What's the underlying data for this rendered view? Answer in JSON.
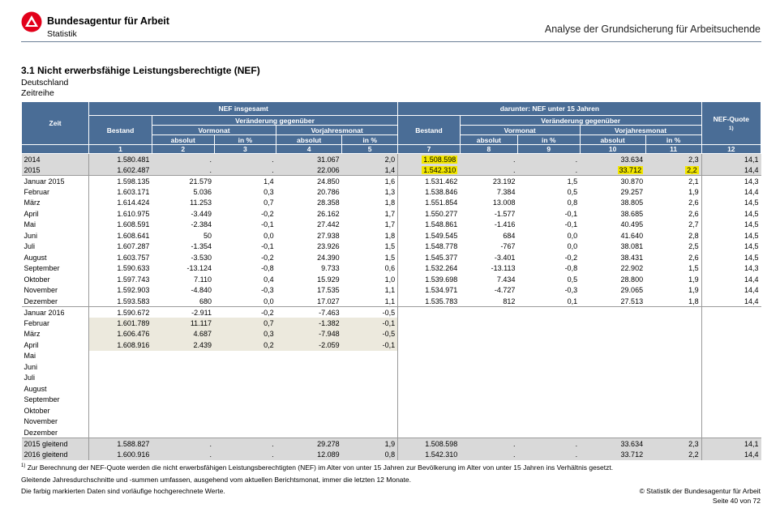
{
  "header": {
    "org_name": "Bundesagentur für Arbeit",
    "org_sub": "Statistik",
    "title": "Analyse der Grundsicherung für Arbeitsuchende",
    "logo_color": "#e2001a"
  },
  "section": {
    "title": "3.1 Nicht erwerbsfähige Leistungsberechtigte (NEF)",
    "region": "Deutschland",
    "series": "Zeitreihe"
  },
  "table": {
    "group_all": "NEF insgesamt",
    "group_u15": "darunter: NEF unter 15 Jahren",
    "zeit": "Zeit",
    "bestand": "Bestand",
    "veraenderung": "Veränderung gegenüber",
    "vormonat": "Vormonat",
    "vorjahresmonat": "Vorjahresmonat",
    "absolut": "absolut",
    "in_pct": "in %",
    "quote": "NEF-Quote",
    "quote_note": "1)",
    "col_numbers": [
      "1",
      "2",
      "3",
      "4",
      "5",
      "7",
      "8",
      "9",
      "10",
      "11",
      "12"
    ],
    "rows": [
      {
        "cells": [
          "2014",
          "1.580.481",
          ".",
          ".",
          "31.067",
          "2,0",
          "1.508.598",
          ".",
          ".",
          "33.634",
          "2,3",
          "14,1"
        ]
      },
      {
        "cells": [
          "2015",
          "1.602.487",
          ".",
          ".",
          "22.006",
          "1,4",
          "1.542.310",
          ".",
          ".",
          "33.712",
          "2,2",
          "14,4"
        ]
      },
      {
        "cells": [
          "Januar 2015",
          "1.598.135",
          "21.579",
          "1,4",
          "24.850",
          "1,6",
          "1.531.462",
          "23.192",
          "1,5",
          "30.870",
          "2,1",
          "14,3"
        ]
      },
      {
        "cells": [
          "Februar",
          "1.603.171",
          "5.036",
          "0,3",
          "20.786",
          "1,3",
          "1.538.846",
          "7.384",
          "0,5",
          "29.257",
          "1,9",
          "14,4"
        ]
      },
      {
        "cells": [
          "März",
          "1.614.424",
          "11.253",
          "0,7",
          "28.358",
          "1,8",
          "1.551.854",
          "13.008",
          "0,8",
          "38.805",
          "2,6",
          "14,5"
        ]
      },
      {
        "cells": [
          "April",
          "1.610.975",
          "-3.449",
          "-0,2",
          "26.162",
          "1,7",
          "1.550.277",
          "-1.577",
          "-0,1",
          "38.685",
          "2,6",
          "14,5"
        ]
      },
      {
        "cells": [
          "Mai",
          "1.608.591",
          "-2.384",
          "-0,1",
          "27.442",
          "1,7",
          "1.548.861",
          "-1.416",
          "-0,1",
          "40.495",
          "2,7",
          "14,5"
        ]
      },
      {
        "cells": [
          "Juni",
          "1.608.641",
          "50",
          "0,0",
          "27.938",
          "1,8",
          "1.549.545",
          "684",
          "0,0",
          "41.640",
          "2,8",
          "14,5"
        ]
      },
      {
        "cells": [
          "Juli",
          "1.607.287",
          "-1.354",
          "-0,1",
          "23.926",
          "1,5",
          "1.548.778",
          "-767",
          "0,0",
          "38.081",
          "2,5",
          "14,5"
        ]
      },
      {
        "cells": [
          "August",
          "1.603.757",
          "-3.530",
          "-0,2",
          "24.390",
          "1,5",
          "1.545.377",
          "-3.401",
          "-0,2",
          "38.431",
          "2,6",
          "14,5"
        ]
      },
      {
        "cells": [
          "September",
          "1.590.633",
          "-13.124",
          "-0,8",
          "9.733",
          "0,6",
          "1.532.264",
          "-13.113",
          "-0,8",
          "22.902",
          "1,5",
          "14,3"
        ]
      },
      {
        "cells": [
          "Oktober",
          "1.597.743",
          "7.110",
          "0,4",
          "15.929",
          "1,0",
          "1.539.698",
          "7.434",
          "0,5",
          "28.800",
          "1,9",
          "14,4"
        ]
      },
      {
        "cells": [
          "November",
          "1.592.903",
          "-4.840",
          "-0,3",
          "17.535",
          "1,1",
          "1.534.971",
          "-4.727",
          "-0,3",
          "29.065",
          "1,9",
          "14,4"
        ]
      },
      {
        "cells": [
          "Dezember",
          "1.593.583",
          "680",
          "0,0",
          "17.027",
          "1,1",
          "1.535.783",
          "812",
          "0,1",
          "27.513",
          "1,8",
          "14,4"
        ]
      },
      {
        "cells": [
          "Januar 2016",
          "1.590.672",
          "-2.911",
          "-0,2",
          "-7.463",
          "-0,5",
          "",
          "",
          "",
          "",
          "",
          ""
        ]
      },
      {
        "cells": [
          "Februar",
          "1.601.789",
          "11.117",
          "0,7",
          "-1.382",
          "-0,1",
          "",
          "",
          "",
          "",
          "",
          ""
        ]
      },
      {
        "cells": [
          "März",
          "1.606.476",
          "4.687",
          "0,3",
          "-7.948",
          "-0,5",
          "",
          "",
          "",
          "",
          "",
          ""
        ]
      },
      {
        "cells": [
          "April",
          "1.608.916",
          "2.439",
          "0,2",
          "-2.059",
          "-0,1",
          "",
          "",
          "",
          "",
          "",
          ""
        ]
      },
      {
        "cells": [
          "Mai",
          "",
          "",
          "",
          "",
          "",
          "",
          "",
          "",
          "",
          "",
          ""
        ]
      },
      {
        "cells": [
          "Juni",
          "",
          "",
          "",
          "",
          "",
          "",
          "",
          "",
          "",
          "",
          ""
        ]
      },
      {
        "cells": [
          "Juli",
          "",
          "",
          "",
          "",
          "",
          "",
          "",
          "",
          "",
          "",
          ""
        ]
      },
      {
        "cells": [
          "August",
          "",
          "",
          "",
          "",
          "",
          "",
          "",
          "",
          "",
          "",
          ""
        ]
      },
      {
        "cells": [
          "September",
          "",
          "",
          "",
          "",
          "",
          "",
          "",
          "",
          "",
          "",
          ""
        ]
      },
      {
        "cells": [
          "Oktober",
          "",
          "",
          "",
          "",
          "",
          "",
          "",
          "",
          "",
          "",
          ""
        ]
      },
      {
        "cells": [
          "November",
          "",
          "",
          "",
          "",
          "",
          "",
          "",
          "",
          "",
          "",
          ""
        ]
      },
      {
        "cells": [
          "Dezember",
          "",
          "",
          "",
          "",
          "",
          "",
          "",
          "",
          "",
          "",
          ""
        ]
      },
      {
        "cells": [
          "2015 gleitend",
          "1.588.827",
          ".",
          ".",
          "29.278",
          "1,9",
          "1.508.598",
          ".",
          ".",
          "33.634",
          "2,3",
          "14,1"
        ]
      },
      {
        "cells": [
          "2016 gleitend",
          "1.600.916",
          ".",
          ".",
          "12.089",
          "0,8",
          "1.542.310",
          ".",
          ".",
          "33.712",
          "2,2",
          "14,4"
        ]
      }
    ]
  },
  "footer": {
    "note1_mark": "1)",
    "note1": " Zur Berechnung der NEF-Quote werden die nicht erwerbsfähigen Leistungsberechtigten (NEF) im Alter von unter 15 Jahren zur Bevölkerung im Alter von unter 15 Jahren ins Verhältnis gesetzt.",
    "note2": "Gleitende Jahresdurchschnitte und -summen umfassen, ausgehend vom aktuellen Berichtsmonat, immer die letzten 12 Monate.",
    "note3": "Die farbig markierten Daten sind vorläufige hochgerechnete Werte.",
    "copyright": "© Statistik der Bundesagentur für Arbeit",
    "page": "Seite 40 von 72"
  }
}
